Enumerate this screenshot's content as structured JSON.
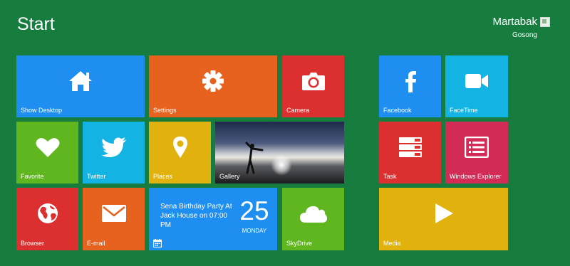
{
  "header": {
    "title": "Start",
    "user_name": "Martabak",
    "user_subtitle": "Gosong"
  },
  "tiles": {
    "show_desktop": {
      "label": "Show Desktop",
      "color": "#1e8ff0",
      "icon": "house-icon"
    },
    "settings": {
      "label": "Settings",
      "color": "#e8621f",
      "icon": "gear-icon"
    },
    "camera": {
      "label": "Camera",
      "color": "#dc2f2f",
      "icon": "camera-icon"
    },
    "facebook": {
      "label": "Facebook",
      "color": "#1e8ff0",
      "icon": "facebook-icon"
    },
    "facetime": {
      "label": "FaceTime",
      "color": "#13b3e4",
      "icon": "video-camera-icon"
    },
    "favorite": {
      "label": "Favorite",
      "color": "#5fb61e",
      "icon": "heart-icon"
    },
    "twitter": {
      "label": "Twitter",
      "color": "#13b3e4",
      "icon": "bird-icon"
    },
    "places": {
      "label": "Places",
      "color": "#e1b20d",
      "icon": "map-pin-icon"
    },
    "gallery": {
      "label": "Gallery",
      "icon": "photo"
    },
    "task": {
      "label": "Task",
      "color": "#dc2f2f",
      "icon": "server-icon"
    },
    "windows_explorer": {
      "label": "Windows Explorer",
      "color": "#d22b56",
      "icon": "list-icon"
    },
    "browser": {
      "label": "Browser",
      "color": "#dc2f2f",
      "icon": "globe-icon"
    },
    "email": {
      "label": "E-mail",
      "color": "#e8621f",
      "icon": "envelope-icon"
    },
    "calendar": {
      "event": "Sena Birthday Party At Jack House on 07:00 PM",
      "day": "25",
      "weekday": "MONDAY",
      "color": "#1e8ff0",
      "icon": "calendar-icon"
    },
    "skydrive": {
      "label": "SkyDrive",
      "color": "#5fb61e",
      "icon": "cloud-icon"
    },
    "media": {
      "label": "Media",
      "color": "#e1b20d",
      "icon": "play-icon"
    }
  }
}
